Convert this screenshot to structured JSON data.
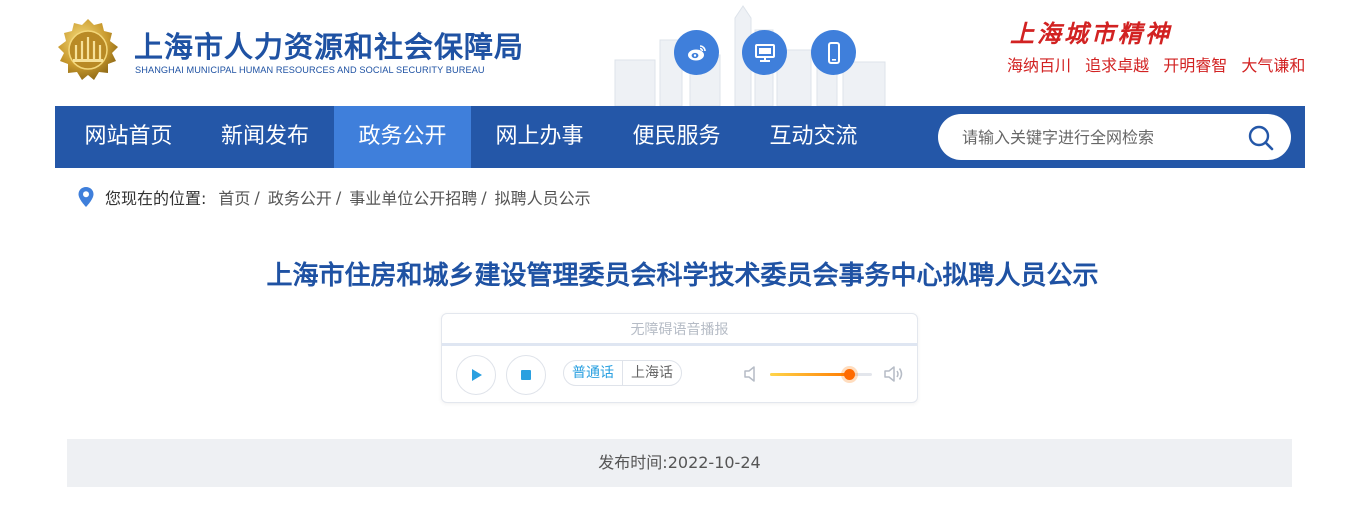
{
  "header": {
    "logo_cn": "上海市人力资源和社会保障局",
    "logo_en": "SHANGHAI MUNICIPAL HUMAN RESOURCES AND SOCIAL SECURITY BUREAU",
    "social_icons": [
      "weibo-icon",
      "desktop-icon",
      "mobile-icon"
    ],
    "spirit_title": "上海城市精神",
    "spirit_words": [
      "海纳百川",
      "追求卓越",
      "开明睿智",
      "大气谦和"
    ]
  },
  "nav": {
    "items": [
      {
        "label": "网站首页",
        "active": false
      },
      {
        "label": "新闻发布",
        "active": false
      },
      {
        "label": "政务公开",
        "active": true
      },
      {
        "label": "网上办事",
        "active": false
      },
      {
        "label": "便民服务",
        "active": false
      },
      {
        "label": "互动交流",
        "active": false
      }
    ],
    "search_placeholder": "请输入关键字进行全网检索"
  },
  "breadcrumb": {
    "label": "您现在的位置:",
    "items": [
      "首页",
      "政务公开",
      "事业单位公开招聘",
      "拟聘人员公示"
    ],
    "separator": "/"
  },
  "article": {
    "title": "上海市住房和城乡建设管理委员会科学技术委员会事务中心拟聘人员公示",
    "publish_label": "发布时间:",
    "publish_date": "2022-10-24"
  },
  "player": {
    "label": "无障碍语音播报",
    "dialects": [
      "普通话",
      "上海话"
    ],
    "selected_dialect": "普通话",
    "volume": 0.78
  },
  "colors": {
    "brand_blue": "#2457a8",
    "nav_active": "#3f7fdb",
    "title_blue": "#1f52a3",
    "spirit_red": "#d22222"
  }
}
